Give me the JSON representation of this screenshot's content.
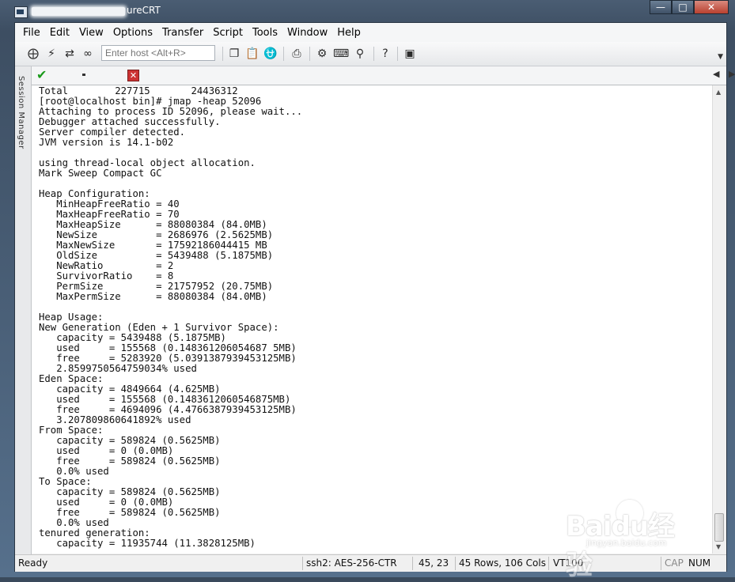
{
  "window": {
    "title_suffix": "ureCRT"
  },
  "menubar": {
    "items": [
      "File",
      "Edit",
      "View",
      "Options",
      "Transfer",
      "Script",
      "Tools",
      "Window",
      "Help"
    ]
  },
  "toolbar": {
    "host_placeholder": "Enter host <Alt+R>"
  },
  "sidebar": {
    "label": "Session Manager"
  },
  "terminal": {
    "lines": [
      "Total        227715       24436312",
      "[root@localhost bin]# jmap -heap 52096",
      "Attaching to process ID 52096, please wait...",
      "Debugger attached successfully.",
      "Server compiler detected.",
      "JVM version is 14.1-b02",
      "",
      "using thread-local object allocation.",
      "Mark Sweep Compact GC",
      "",
      "Heap Configuration:",
      "   MinHeapFreeRatio = 40",
      "   MaxHeapFreeRatio = 70",
      "   MaxHeapSize      = 88080384 (84.0MB)",
      "   NewSize          = 2686976 (2.5625MB)",
      "   MaxNewSize       = 17592186044415 MB",
      "   OldSize          = 5439488 (5.1875MB)",
      "   NewRatio         = 2",
      "   SurvivorRatio    = 8",
      "   PermSize         = 21757952 (20.75MB)",
      "   MaxPermSize      = 88080384 (84.0MB)",
      "",
      "Heap Usage:",
      "New Generation (Eden + 1 Survivor Space):",
      "   capacity = 5439488 (5.1875MB)",
      "   used     = 155568 (0.148361206054687 5MB)",
      "   free     = 5283920 (5.0391387939453125MB)",
      "   2.8599750564759034% used",
      "Eden Space:",
      "   capacity = 4849664 (4.625MB)",
      "   used     = 155568 (0.1483612060546875MB)",
      "   free     = 4694096 (4.4766387939453125MB)",
      "   3.207809860641892% used",
      "From Space:",
      "   capacity = 589824 (0.5625MB)",
      "   used     = 0 (0.0MB)",
      "   free     = 589824 (0.5625MB)",
      "   0.0% used",
      "To Space:",
      "   capacity = 589824 (0.5625MB)",
      "   used     = 0 (0.0MB)",
      "   free     = 589824 (0.5625MB)",
      "   0.0% used",
      "tenured generation:",
      "   capacity = 11935744 (11.3828125MB)"
    ]
  },
  "statusbar": {
    "ready": "Ready",
    "cipher": "ssh2: AES-256-CTR",
    "cursor": "45,  23",
    "size": "45 Rows, 106 Cols",
    "emulation": "VT100",
    "cap": "CAP",
    "num": "NUM"
  },
  "watermark": {
    "text": "Baidu经验",
    "sub": "jingyan.baidu.com"
  },
  "colors": {
    "accent_close": "#cc3333",
    "check_green": "#1b9a1b"
  }
}
